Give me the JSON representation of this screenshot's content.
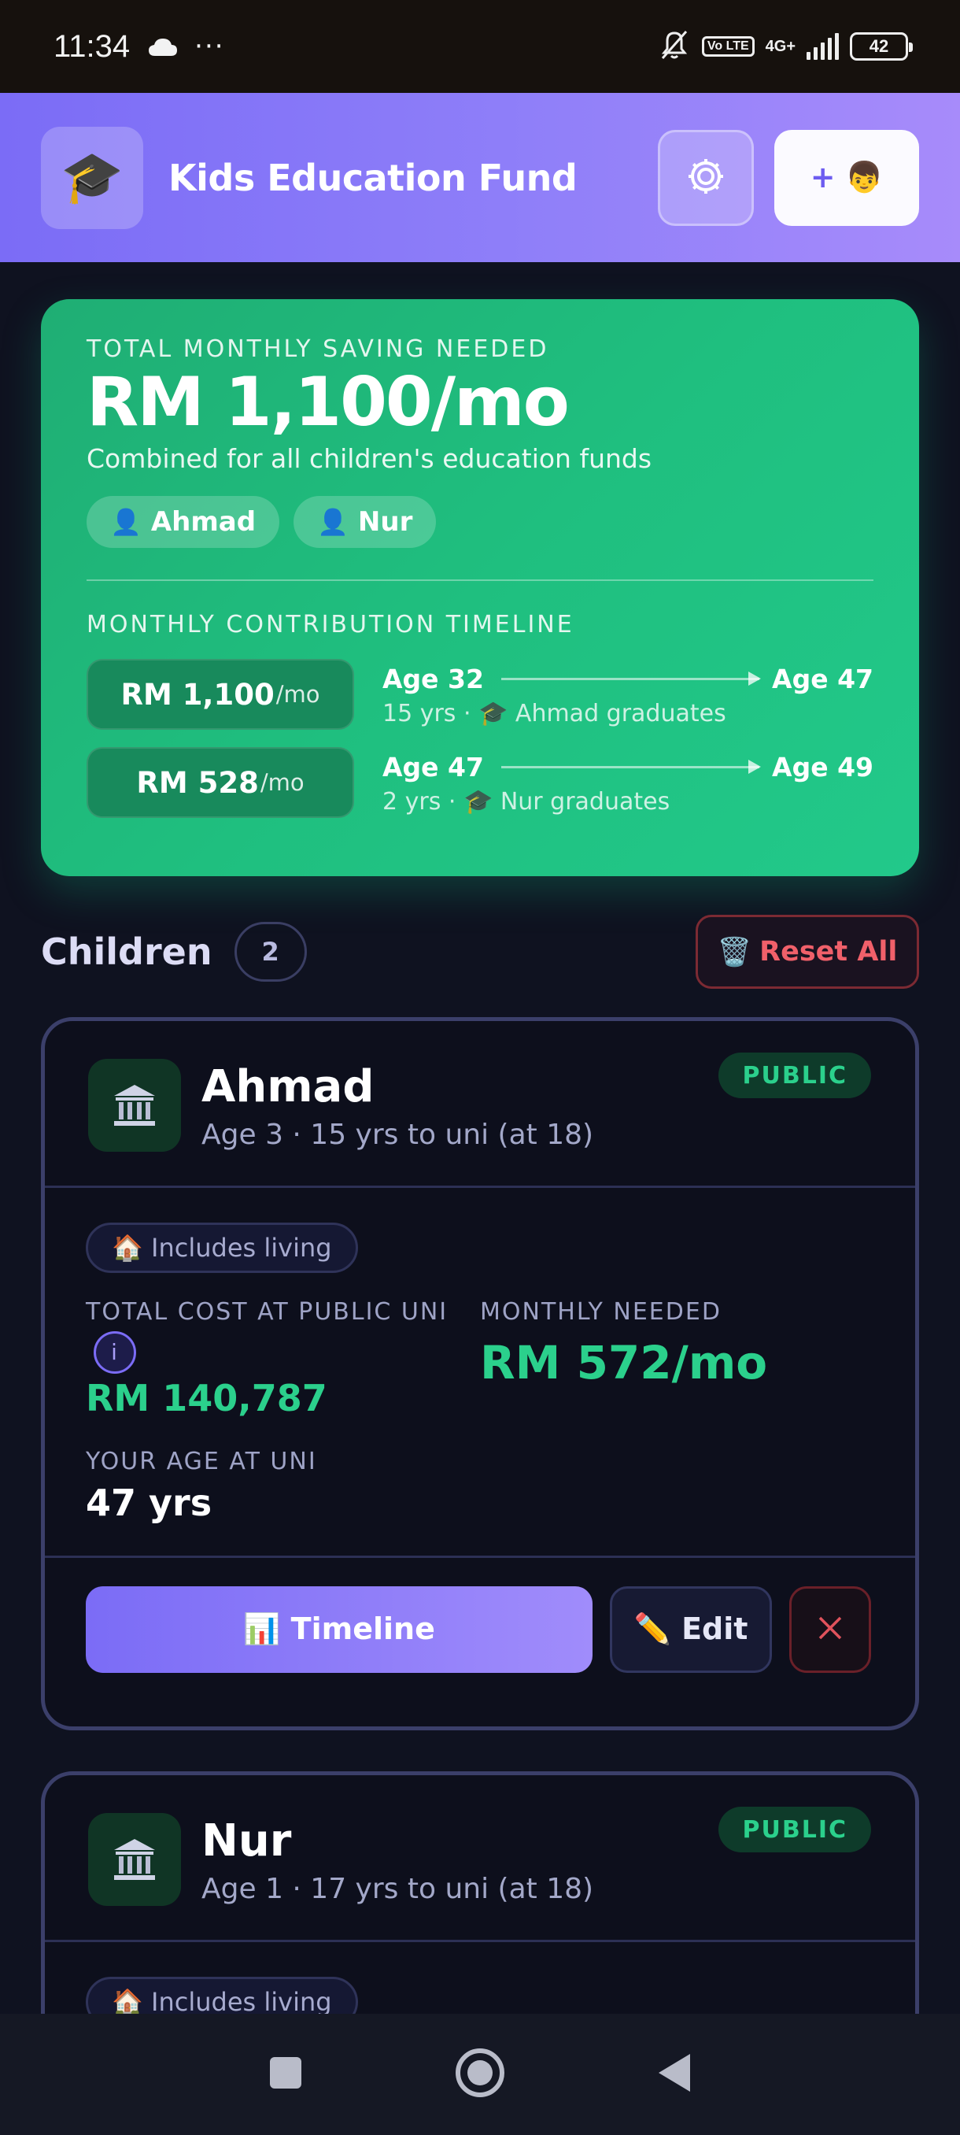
{
  "status_bar": {
    "time": "11:34",
    "dots": "···",
    "volte": "Vo LTE",
    "network": "4G+",
    "battery": "42"
  },
  "header": {
    "logo_emoji": "🎓",
    "title": "Kids Education Fund",
    "add_child_label": "+ 👦"
  },
  "summary": {
    "kicker": "TOTAL MONTHLY SAVING NEEDED",
    "amount": "RM 1,100/mo",
    "subtitle": "Combined for all children's education funds",
    "chips": [
      "Ahmad",
      "Nur"
    ],
    "timeline_label": "MONTHLY CONTRIBUTION TIMELINE",
    "timeline": [
      {
        "amount": "RM 1,100",
        "unit": "/mo",
        "from": "Age 32",
        "to": "Age 47",
        "desc": "15 yrs · 🎓 Ahmad graduates"
      },
      {
        "amount": "RM 528",
        "unit": "/mo",
        "from": "Age 47",
        "to": "Age 49",
        "desc": "2 yrs · 🎓 Nur graduates"
      }
    ]
  },
  "children_section": {
    "title": "Children",
    "count": "2",
    "reset_label": "Reset All"
  },
  "children": [
    {
      "name": "Ahmad",
      "meta": "Age 3 · 15 yrs to uni (at 18)",
      "badge": "PUBLIC",
      "living": "🏠 Includes living",
      "total_cost_label": "TOTAL COST AT PUBLIC UNI",
      "info_mark": "i",
      "total_cost": "RM 140,787",
      "monthly_label": "MONTHLY NEEDED",
      "monthly": "RM 572/mo",
      "your_age_label": "YOUR AGE AT UNI",
      "your_age": "47 yrs",
      "timeline_btn": "📊 Timeline",
      "edit_btn": "✏️ Edit"
    },
    {
      "name": "Nur",
      "meta": "Age 1 · 17 yrs to uni (at 18)",
      "badge": "PUBLIC",
      "living": "🏠 Includes living"
    }
  ],
  "colors": {
    "accent": "#7b6cf6",
    "success": "#2bd08c",
    "danger": "#f0606a",
    "background": "#0f1220"
  }
}
